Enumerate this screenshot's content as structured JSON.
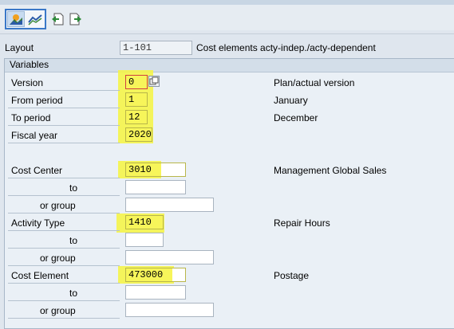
{
  "toolbar": {
    "buttons": [
      {
        "icon": "chart-mountain-icon"
      },
      {
        "icon": "chart-line-icon"
      },
      {
        "icon": "back-document-icon"
      },
      {
        "icon": "forward-document-icon"
      }
    ]
  },
  "layout": {
    "label": "Layout",
    "value": "1-101",
    "description": "Cost elements acty-indep./acty-dependent"
  },
  "variables": {
    "title": "Variables",
    "version": {
      "label": "Version",
      "value": "0",
      "description": "Plan/actual version"
    },
    "from_period": {
      "label": "From period",
      "value": "1",
      "description": "January"
    },
    "to_period": {
      "label": "To period",
      "value": "12",
      "description": "December"
    },
    "fiscal_year": {
      "label": "Fiscal year",
      "value": "2020"
    },
    "cost_center": {
      "label": "Cost Center",
      "value": "3010",
      "description": "Management Global Sales",
      "to_label": "to",
      "group_label": "or group"
    },
    "activity_type": {
      "label": "Activity Type",
      "value": "1410",
      "description": "Repair Hours",
      "to_label": "to",
      "group_label": "or group"
    },
    "cost_element": {
      "label": "Cost Element",
      "value": "473000",
      "description": "Postage",
      "to_label": "to",
      "group_label": "or group"
    }
  },
  "colors": {
    "highlight": "#f5f44a",
    "selection": "#3a78c8"
  }
}
